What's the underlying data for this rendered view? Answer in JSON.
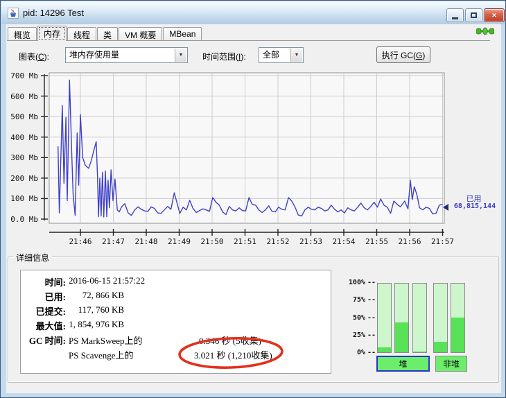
{
  "window": {
    "title": "pid: 14296 Test"
  },
  "icons": {
    "app": "java-coffee-cup",
    "minimize": "horizontal-bar",
    "maximize": "square-outline",
    "close_glyph": "×",
    "connection": "green-plug-connected",
    "dropdown_arrow": "▼",
    "series_marker": "left-triangle"
  },
  "tabs": [
    {
      "label": "概览",
      "active": false
    },
    {
      "label": "内存",
      "active": true
    },
    {
      "label": "线程",
      "active": false
    },
    {
      "label": "类",
      "active": false
    },
    {
      "label": "VM 概要",
      "active": false
    },
    {
      "label": "MBean",
      "active": false
    }
  ],
  "toolbar": {
    "chart_label_pre": "图表(",
    "chart_label_key": "C",
    "chart_label_post": "):",
    "chart_value": "堆内存使用量",
    "range_label_pre": "时间范围(",
    "range_label_key": "I",
    "range_label_post": "):",
    "range_value": "全部",
    "gc_pre": "执行 GC(",
    "gc_key": "G",
    "gc_post": ")"
  },
  "chart_data": {
    "type": "line",
    "title": "堆内存使用量",
    "ylabel": "Mb",
    "ylim": [
      0,
      700
    ],
    "y_ticks": [
      "700 Mb",
      "600 Mb",
      "500 Mb",
      "400 Mb",
      "300 Mb",
      "200 Mb",
      "100 Mb",
      "0.0 Mb"
    ],
    "x_ticks": [
      "21:46",
      "21:47",
      "21:48",
      "21:49",
      "21:50",
      "21:51",
      "21:52",
      "21:53",
      "21:54",
      "21:55",
      "21:56",
      "21:57"
    ],
    "grid": true,
    "annotation": {
      "label": "已用",
      "value": "68,815,144"
    },
    "series": [
      {
        "name": "已用",
        "color": "#4040c8",
        "points": [
          [
            -0.68,
            355
          ],
          [
            -0.64,
            30
          ],
          [
            -0.55,
            555
          ],
          [
            -0.5,
            175
          ],
          [
            -0.44,
            495
          ],
          [
            -0.4,
            90
          ],
          [
            -0.33,
            678
          ],
          [
            -0.26,
            300
          ],
          [
            -0.22,
            120
          ],
          [
            -0.16,
            18
          ],
          [
            -0.1,
            420
          ],
          [
            -0.05,
            165
          ],
          [
            0.0,
            510
          ],
          [
            0.07,
            300
          ],
          [
            0.15,
            262
          ],
          [
            0.25,
            248
          ],
          [
            0.33,
            285
          ],
          [
            0.4,
            330
          ],
          [
            0.48,
            378
          ],
          [
            0.52,
            205
          ],
          [
            0.55,
            12
          ],
          [
            0.59,
            200
          ],
          [
            0.63,
            15
          ],
          [
            0.67,
            228
          ],
          [
            0.71,
            10
          ],
          [
            0.76,
            235
          ],
          [
            0.8,
            12
          ],
          [
            0.84,
            190
          ],
          [
            0.88,
            55
          ],
          [
            0.93,
            240
          ],
          [
            0.99,
            90
          ],
          [
            1.05,
            195
          ],
          [
            1.12,
            45
          ],
          [
            1.18,
            35
          ],
          [
            1.25,
            60
          ],
          [
            1.35,
            75
          ],
          [
            1.45,
            30
          ],
          [
            1.55,
            18
          ],
          [
            1.65,
            45
          ],
          [
            1.75,
            60
          ],
          [
            1.85,
            48
          ],
          [
            1.95,
            40
          ],
          [
            2.05,
            38
          ],
          [
            2.15,
            60
          ],
          [
            2.25,
            52
          ],
          [
            2.35,
            30
          ],
          [
            2.45,
            28
          ],
          [
            2.55,
            45
          ],
          [
            2.65,
            62
          ],
          [
            2.75,
            48
          ],
          [
            2.85,
            128
          ],
          [
            2.95,
            70
          ],
          [
            3.02,
            28
          ],
          [
            3.12,
            58
          ],
          [
            3.22,
            45
          ],
          [
            3.32,
            92
          ],
          [
            3.42,
            52
          ],
          [
            3.52,
            32
          ],
          [
            3.62,
            42
          ],
          [
            3.72,
            50
          ],
          [
            3.82,
            45
          ],
          [
            3.92,
            38
          ],
          [
            4.02,
            105
          ],
          [
            4.12,
            82
          ],
          [
            4.22,
            68
          ],
          [
            4.32,
            35
          ],
          [
            4.42,
            22
          ],
          [
            4.52,
            62
          ],
          [
            4.62,
            45
          ],
          [
            4.72,
            40
          ],
          [
            4.82,
            55
          ],
          [
            4.92,
            42
          ],
          [
            5.02,
            40
          ],
          [
            5.12,
            105
          ],
          [
            5.22,
            72
          ],
          [
            5.32,
            68
          ],
          [
            5.42,
            45
          ],
          [
            5.52,
            32
          ],
          [
            5.62,
            45
          ],
          [
            5.72,
            65
          ],
          [
            5.82,
            38
          ],
          [
            5.92,
            35
          ],
          [
            6.02,
            58
          ],
          [
            6.12,
            48
          ],
          [
            6.22,
            45
          ],
          [
            6.32,
            105
          ],
          [
            6.42,
            88
          ],
          [
            6.52,
            58
          ],
          [
            6.62,
            20
          ],
          [
            6.72,
            15
          ],
          [
            6.82,
            45
          ],
          [
            6.92,
            58
          ],
          [
            7.02,
            48
          ],
          [
            7.12,
            45
          ],
          [
            7.22,
            58
          ],
          [
            7.32,
            52
          ],
          [
            7.42,
            40
          ],
          [
            7.52,
            45
          ],
          [
            7.62,
            68
          ],
          [
            7.72,
            48
          ],
          [
            7.82,
            35
          ],
          [
            7.92,
            45
          ],
          [
            8.02,
            30
          ],
          [
            8.12,
            55
          ],
          [
            8.22,
            45
          ],
          [
            8.32,
            40
          ],
          [
            8.42,
            58
          ],
          [
            8.52,
            78
          ],
          [
            8.62,
            55
          ],
          [
            8.72,
            45
          ],
          [
            8.82,
            62
          ],
          [
            8.92,
            82
          ],
          [
            9.02,
            58
          ],
          [
            9.12,
            98
          ],
          [
            9.22,
            68
          ],
          [
            9.32,
            58
          ],
          [
            9.42,
            28
          ],
          [
            9.52,
            88
          ],
          [
            9.62,
            72
          ],
          [
            9.72,
            60
          ],
          [
            9.85,
            88
          ],
          [
            9.95,
            50
          ],
          [
            10.02,
            190
          ],
          [
            10.08,
            95
          ],
          [
            10.14,
            158
          ],
          [
            10.22,
            118
          ],
          [
            10.3,
            55
          ],
          [
            10.4,
            45
          ],
          [
            10.5,
            58
          ],
          [
            10.6,
            52
          ],
          [
            10.7,
            25
          ],
          [
            10.8,
            28
          ],
          [
            10.9,
            68
          ],
          [
            11.0,
            72
          ]
        ]
      }
    ]
  },
  "details": {
    "title": "详细信息",
    "rows": [
      {
        "label": "时间:",
        "value": "2016-06-15 21:57:22",
        "align": "left"
      },
      {
        "label": "已用:",
        "value": "72, 866 KB",
        "align": "right"
      },
      {
        "label": "已提交:",
        "value": "117, 760 KB",
        "align": "right"
      },
      {
        "label": "最大值:",
        "value": "1, 854, 976 KB",
        "align": "right"
      }
    ],
    "gc_rows": [
      {
        "label": "GC 时间:",
        "name": "PS MarkSweep上的",
        "value": "0.346 秒 (5收集)"
      },
      {
        "label": "",
        "name": "PS Scavenge上的",
        "value": "3.021 秒 (1,210收集)"
      }
    ]
  },
  "gauge": {
    "ticks": [
      "100%",
      "75%",
      "50%",
      "25%",
      "0%"
    ],
    "dash": "--",
    "bars_fill_percent": [
      7,
      43,
      1,
      15,
      51
    ],
    "buttons": [
      {
        "label": "堆",
        "selected": true
      },
      {
        "label": "非堆",
        "selected": false
      }
    ]
  },
  "colors": {
    "line": "#4040c8",
    "annotation_text": "#3a3ac8",
    "highlight_circle": "#e2301d",
    "grid": "#cccccc",
    "plot_bg": "#f8f8f8",
    "gauge_bar_bg": "#cdf6cd",
    "gauge_bar_fill": "#57e257",
    "gauge_button_bg": "#6cee6c"
  }
}
